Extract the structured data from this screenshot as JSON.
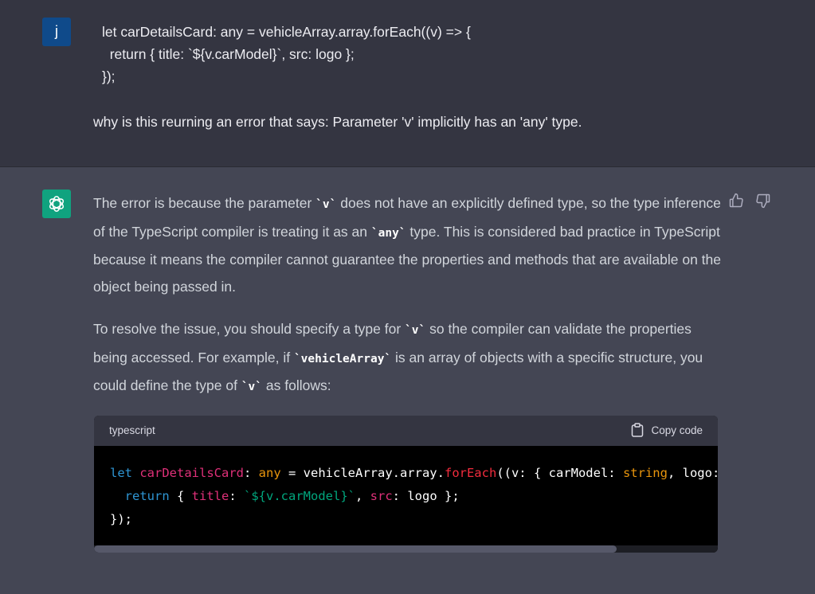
{
  "user": {
    "avatar_letter": "j",
    "code_lines": [
      "let carDetailsCard: any = vehicleArray.array.forEach((v) => {",
      "  return { title: `${v.carModel}`, src: logo };",
      "});"
    ],
    "question": "why is this reurning an error that says: Parameter 'v' implicitly has an 'any' type."
  },
  "assistant": {
    "p1": {
      "a": "The error is because the parameter ",
      "code1": "`v`",
      "b": " does not have an explicitly defined type, so the type inference of the TypeScript compiler is treating it as an ",
      "code2": "`any`",
      "c": " type. This is considered bad practice in TypeScript because it means the compiler cannot guarantee the properties and methods that are available on the object being passed in."
    },
    "p2": {
      "a": "To resolve the issue, you should specify a type for ",
      "code1": "`v`",
      "b": " so the compiler can validate the properties being accessed. For example, if ",
      "code2": "`vehicleArray`",
      "c": " is an array of objects with a specific structure, you could define the type of ",
      "code3": "`v`",
      "d": " as follows:"
    },
    "code_block": {
      "language": "typescript",
      "copy_label": "Copy code",
      "line1": {
        "t1": "let",
        "t2": "carDetailsCard",
        "t3": ": ",
        "t4": "any",
        "t5": " = vehicleArray.array.",
        "t6": "forEach",
        "t7": "((v: { carModel: ",
        "t8": "string",
        "t9": ", logo: "
      },
      "line2": {
        "t1": "return",
        "t2": " { ",
        "t3": "title",
        "t4": ": ",
        "t5": "`${v.carModel}`",
        "t6": ", ",
        "t7": "src",
        "t8": ": logo };"
      },
      "line3": "});"
    }
  },
  "colors": {
    "user_bg": "#343541",
    "assistant_bg": "#444654",
    "user_avatar": "#0f4a8a",
    "assistant_avatar": "#10a37f"
  },
  "icons": {
    "assistant_logo": "openai-logo-icon",
    "thumbs_up": "thumbs-up-icon",
    "thumbs_down": "thumbs-down-icon",
    "copy": "clipboard-icon"
  }
}
